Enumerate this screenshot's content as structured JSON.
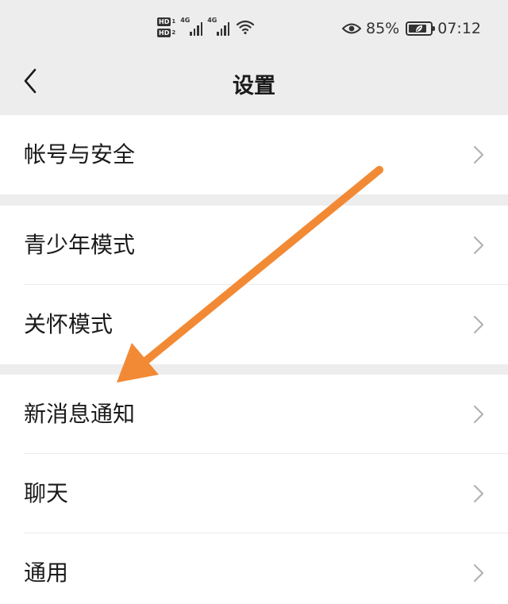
{
  "status_bar": {
    "hd1_label": "HD",
    "hd1_sim": "1",
    "hd2_label": "HD",
    "hd2_sim": "2",
    "network1": "4G",
    "network2": "4G",
    "battery_percent": "85%",
    "battery_level": 0.85,
    "time": "07:12",
    "icons": [
      "signal-icon",
      "wifi-icon",
      "eye-icon",
      "battery-icon"
    ]
  },
  "nav": {
    "title": "设置",
    "back_icon": "chevron-left-icon"
  },
  "groups": [
    {
      "items": [
        {
          "label": "帐号与安全"
        }
      ]
    },
    {
      "items": [
        {
          "label": "青少年模式"
        },
        {
          "label": "关怀模式"
        }
      ]
    },
    {
      "items": [
        {
          "label": "新消息通知"
        },
        {
          "label": "聊天"
        },
        {
          "label": "通用"
        }
      ]
    }
  ],
  "colors": {
    "background": "#ededed",
    "surface": "#ffffff",
    "text": "#1a1a1a",
    "chevron": "#b2b2b2",
    "annotation_arrow": "#f28a35"
  }
}
